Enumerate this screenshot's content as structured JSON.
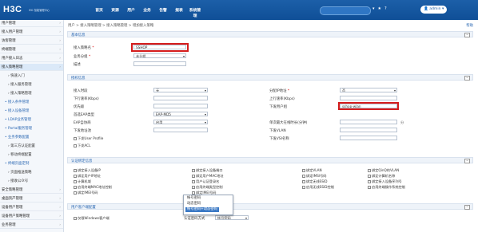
{
  "header": {
    "logo": "H3C",
    "logo_sub": "iMC 智能管理中心",
    "nav": [
      "首页",
      "资源",
      "用户",
      "业务",
      "告警",
      "报表",
      "系统管理"
    ],
    "icons": [
      "refresh-icon",
      "star-icon",
      "help-icon"
    ],
    "user_label": "admin"
  },
  "sidebar": {
    "items": [
      {
        "label": "用户管理",
        "level": "top"
      },
      {
        "label": "接入用户管理",
        "level": "top"
      },
      {
        "label": "访客管理",
        "level": "top"
      },
      {
        "label": "终端管理",
        "level": "top"
      },
      {
        "label": "用户接入日志",
        "level": "top"
      },
      {
        "label": "接入策略管理",
        "level": "top",
        "selected": true
      },
      {
        "label": "快速入门",
        "level": "sub2"
      },
      {
        "label": "接入服务管理",
        "level": "sub2"
      },
      {
        "label": "接入策略管理",
        "level": "sub2"
      },
      {
        "label": "接入条件管理",
        "level": "sub"
      },
      {
        "label": "接入设备管理",
        "level": "sub"
      },
      {
        "label": "LDAP业务管理",
        "level": "sub"
      },
      {
        "label": "Portal服务管理",
        "level": "sub"
      },
      {
        "label": "业务参数配置",
        "level": "sub"
      },
      {
        "label": "第三方认证配置",
        "level": "sub2"
      },
      {
        "label": "移动终端配置",
        "level": "sub2"
      },
      {
        "label": "终端页面定制",
        "level": "sub"
      },
      {
        "label": "页面推送策略",
        "level": "sub2"
      },
      {
        "label": "接收公众号",
        "level": "sub2"
      },
      {
        "label": "安全策略管理",
        "level": "top"
      },
      {
        "label": "桌面资产管理",
        "level": "top"
      },
      {
        "label": "设备用户管理",
        "level": "top"
      },
      {
        "label": "设备用户策略管理",
        "level": "top"
      },
      {
        "label": "业务管理",
        "level": "top"
      }
    ]
  },
  "breadcrumb": "用户 > 接入策略管理 > 接入策略管理 > 增加接入策略",
  "help_label": "帮助",
  "basic": {
    "section_title": "基本信息",
    "name_label": "接入策略名",
    "name_value": "SSHOP",
    "group_label": "业务分组",
    "group_value": "未分组",
    "desc_label": "描述",
    "desc_value": ""
  },
  "auth": {
    "section_title": "授权信息",
    "time_label": "接入时段",
    "time_value": "无",
    "down_rate_label": "下行速率(Kbps)",
    "down_rate_value": "",
    "priority_label": "优先级",
    "priority_value": "",
    "eap_type_label": "首选EAP类型",
    "eap_type_value": "EAP-MD5",
    "eap_auto_label": "EAP自协商",
    "eap_auto_value": "启用",
    "acl_label": "下发地址池",
    "acl_value": "",
    "user_profile_label": "下发User Profile",
    "user_acl_label": "下发ACL",
    "ip_label": "分配IP地址",
    "ip_value": "否",
    "up_rate_label": "上行速率(Kbps)",
    "up_rate_value": "",
    "user_group_label": "下发用户组",
    "user_group_value": "sshop-wlan",
    "max_online_label": "单次最大在线时长(分钟)",
    "max_online_value": "",
    "vlan_label": "下发VLAN",
    "vlan_value": "",
    "vsi_label": "下发VSI名称",
    "vsi_value": ""
  },
  "bind": {
    "section_title": "认证绑定信息",
    "checks": [
      [
        "绑定接入设备IP",
        "绑定接入设备端口",
        "绑定VLAN",
        "绑定QinQ的VLAN"
      ],
      [
        "绑定用户IP地址",
        "绑定用户MAC地址",
        "绑定IMSI号码",
        "绑定计算机名称"
      ],
      [
        "计算机域",
        "用户认证登录名",
        "绑定无线SSID",
        "绑定接入设备序列号"
      ],
      [
        "启用终端MAC地址控制",
        "启用终端类型控制",
        "启用无线SSID控制",
        "启用终端操作系统控制"
      ],
      [
        "绑定IMEI号码",
        "绑定IMEI号码",
        "",
        ""
      ]
    ]
  },
  "client": {
    "section_title": "用户客户端配置",
    "windows_label": "仅限Windows客户端",
    "auth_method_label": "认证密码方式",
    "auth_method_value": "帐号密码",
    "options": [
      "帐号密码",
      "动态密码",
      "帐号密码+动态密码"
    ]
  },
  "colors": {
    "header": "#1c5fa8",
    "highlight": "#d41c1c",
    "dropdown_active": "#3a78c4"
  }
}
